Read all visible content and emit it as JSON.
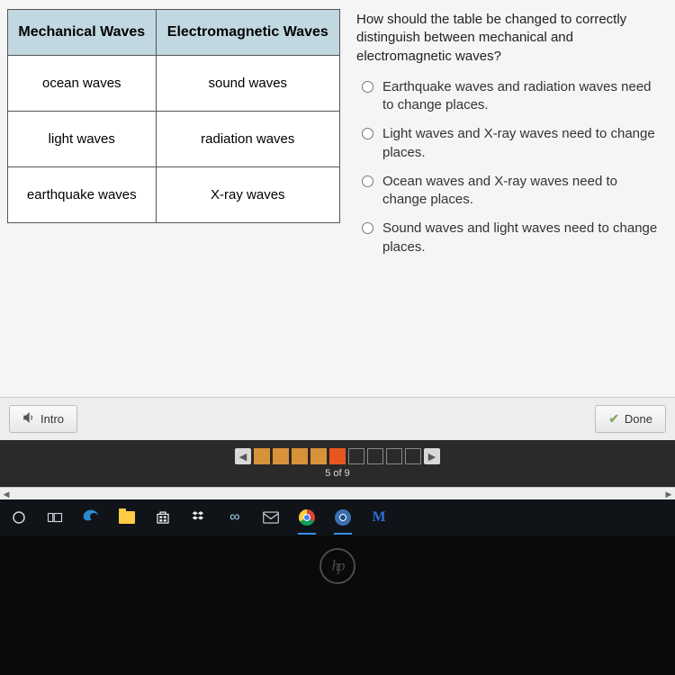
{
  "table": {
    "headers": [
      "Mechanical Waves",
      "Electromagnetic Waves"
    ],
    "rows": [
      [
        "ocean waves",
        "sound waves"
      ],
      [
        "light waves",
        "radiation waves"
      ],
      [
        "earthquake waves",
        "X-ray waves"
      ]
    ]
  },
  "question": "How should the table be changed to correctly distinguish between mechanical and electromagnetic waves?",
  "choices": [
    "Earthquake waves and radiation waves need to change places.",
    "Light waves and X-ray waves need to change places.",
    "Ocean waves and X-ray waves need to change places.",
    "Sound waves and light waves need to change places."
  ],
  "footer": {
    "intro": "Intro",
    "done": "Done"
  },
  "nav": {
    "counter": "5 of 9",
    "total": 9,
    "current": 5,
    "completed": 4
  },
  "logo": "hp"
}
